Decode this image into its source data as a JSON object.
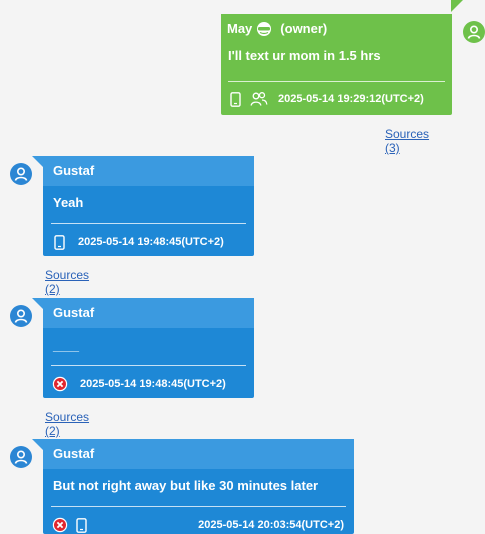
{
  "colors": {
    "owner_bubble": "#6ec14a",
    "contact_bubble": "#1e88d6",
    "contact_header": "#3b9ae0",
    "link": "#2a62b8",
    "error_badge": "#e0262f"
  },
  "messages": [
    {
      "sender": "May",
      "sender_icon": "sleep-mask-emoji-icon",
      "role": "(owner)",
      "text": "I'll text ur mom in 1.5 hrs",
      "icons": [
        "phone-icon",
        "group-icon"
      ],
      "timestamp": "2025-05-14 19:29:12(UTC+2)",
      "sources": "Sources (3)"
    },
    {
      "sender": "Gustaf",
      "text": "Yeah",
      "icons": [
        "phone-icon"
      ],
      "timestamp": "2025-05-14 19:48:45(UTC+2)",
      "sources": "Sources (2)"
    },
    {
      "sender": "Gustaf",
      "text": "____",
      "icons": [
        "error-icon"
      ],
      "timestamp": "2025-05-14 19:48:45(UTC+2)",
      "sources": "Sources (2)"
    },
    {
      "sender": "Gustaf",
      "text": "But not right away but like 30 minutes later",
      "icons": [
        "error-icon",
        "phone-icon"
      ],
      "timestamp": "2025-05-14 20:03:54(UTC+2)"
    }
  ]
}
